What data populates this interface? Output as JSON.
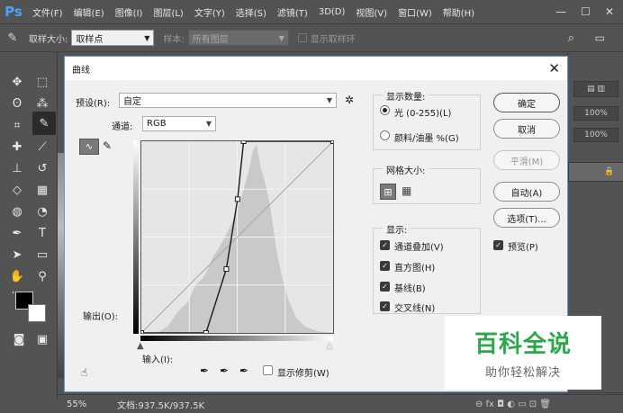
{
  "menubar": {
    "logo": "Ps",
    "items": [
      "文件(F)",
      "编辑(E)",
      "图像(I)",
      "图层(L)",
      "文字(Y)",
      "选择(S)",
      "滤镜(T)",
      "3D(D)",
      "视图(V)",
      "窗口(W)",
      "帮助(H)"
    ],
    "minimize": "—",
    "maximize": "☐",
    "close": "✕"
  },
  "optbar": {
    "sample_size_label": "取样大小:",
    "sample_size_value": "取样点",
    "sample_label": "样本:",
    "sample_value": "所有图层",
    "show_ring_label": "显示取样环"
  },
  "rightpanel": {
    "opacity1": "100%",
    "opacity2": "100%"
  },
  "statusbar": {
    "zoom": "55%",
    "doc": "文档:937.5K/937.5K"
  },
  "dialog": {
    "title": "曲线",
    "preset_label": "预设(R):",
    "preset_value": "自定",
    "channel_label": "通道:",
    "channel_value": "RGB",
    "output_label": "输出(O):",
    "input_label": "输入(I):",
    "show_clipping_label": "显示修剪(W)",
    "buttons": {
      "ok": "确定",
      "cancel": "取消",
      "smooth": "平滑(M)",
      "auto": "自动(A)",
      "options": "选项(T)..."
    },
    "preview_label": "预览(P)",
    "display_amount": {
      "title": "显示数量:",
      "light": "光 (0-255)(L)",
      "pigment": "颜料/油墨 %(G)"
    },
    "grid_size": {
      "title": "网格大小:"
    },
    "show": {
      "title": "显示:",
      "channel_overlays": "通道叠加(V)",
      "histogram": "直方图(H)",
      "baseline": "基线(B)",
      "intersection": "交叉线(N)"
    }
  },
  "curve": {
    "input_range": [
      0,
      255
    ],
    "output_range": [
      0,
      255
    ],
    "points": [
      [
        0,
        0
      ],
      [
        86,
        0
      ],
      [
        113,
        85
      ],
      [
        128,
        178
      ],
      [
        136,
        255
      ],
      [
        255,
        255
      ]
    ]
  },
  "watermark": {
    "main": "百科全说",
    "sub": "助你轻松解决"
  },
  "colors": {
    "ps_blue": "#4aa3ff",
    "watermark_green": "#2aa84a",
    "histogram_gray": "#c9c9c9"
  }
}
